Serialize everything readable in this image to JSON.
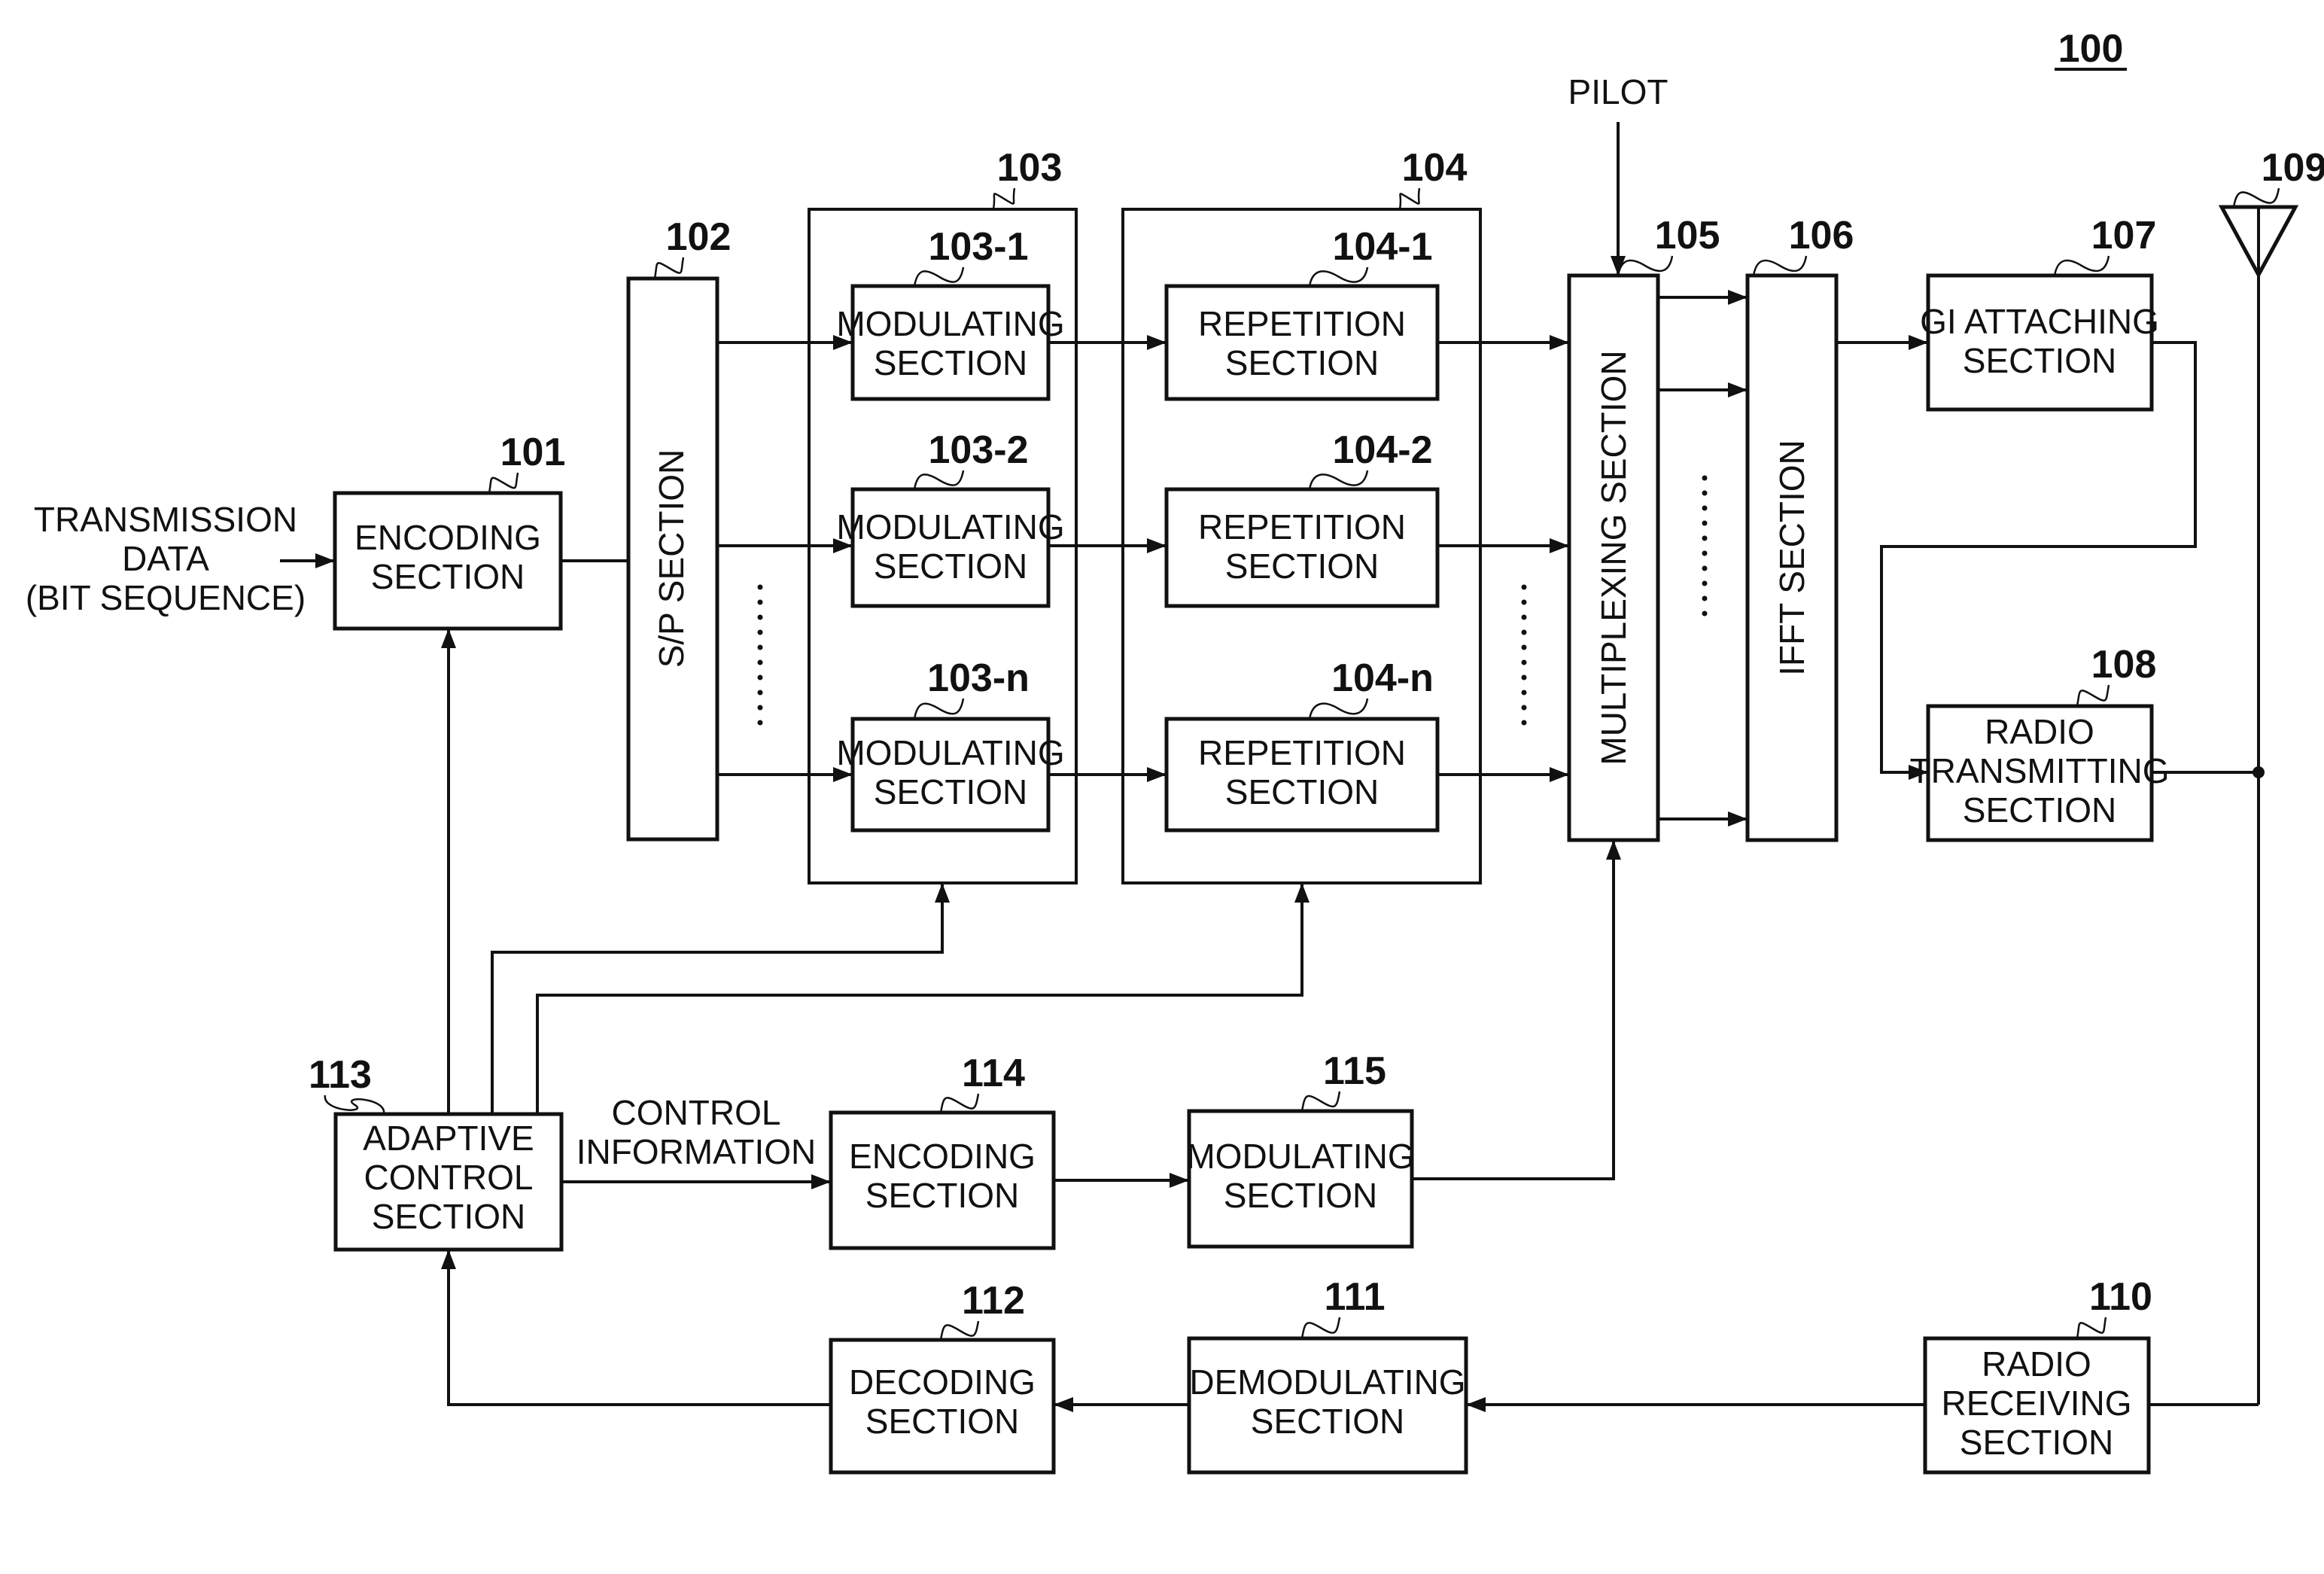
{
  "figure_number": "100",
  "input_label": [
    "TRANSMISSION",
    "DATA",
    "(BIT SEQUENCE)"
  ],
  "pilot_label": "PILOT",
  "control_info_label": [
    "CONTROL",
    "INFORMATION"
  ],
  "blocks": {
    "encoding_101": {
      "ref": "101",
      "lines": [
        "ENCODING",
        "SECTION"
      ]
    },
    "sp_102": {
      "ref": "102",
      "lines": [
        "S/P SECTION"
      ]
    },
    "modulating_group_103": {
      "ref": "103"
    },
    "modulating_103_1": {
      "ref": "103-1",
      "lines": [
        "MODULATING",
        "SECTION"
      ]
    },
    "modulating_103_2": {
      "ref": "103-2",
      "lines": [
        "MODULATING",
        "SECTION"
      ]
    },
    "modulating_103_n": {
      "ref": "103-n",
      "lines": [
        "MODULATING",
        "SECTION"
      ]
    },
    "repetition_group_104": {
      "ref": "104"
    },
    "repetition_104_1": {
      "ref": "104-1",
      "lines": [
        "REPETITION",
        "SECTION"
      ]
    },
    "repetition_104_2": {
      "ref": "104-2",
      "lines": [
        "REPETITION",
        "SECTION"
      ]
    },
    "repetition_104_n": {
      "ref": "104-n",
      "lines": [
        "REPETITION",
        "SECTION"
      ]
    },
    "multiplexing_105": {
      "ref": "105",
      "lines": [
        "MULTIPLEXING SECTION"
      ]
    },
    "ifft_106": {
      "ref": "106",
      "lines": [
        "IFFT SECTION"
      ]
    },
    "gi_107": {
      "ref": "107",
      "lines": [
        "GI ATTACHING",
        "SECTION"
      ]
    },
    "radio_tx_108": {
      "ref": "108",
      "lines": [
        "RADIO",
        "TRANSMITTING",
        "SECTION"
      ]
    },
    "antenna_109": {
      "ref": "109"
    },
    "radio_rx_110": {
      "ref": "110",
      "lines": [
        "RADIO",
        "RECEIVING",
        "SECTION"
      ]
    },
    "demodulating_111": {
      "ref": "111",
      "lines": [
        "DEMODULATING",
        "SECTION"
      ]
    },
    "decoding_112": {
      "ref": "112",
      "lines": [
        "DECODING",
        "SECTION"
      ]
    },
    "adaptive_113": {
      "ref": "113",
      "lines": [
        "ADAPTIVE",
        "CONTROL",
        "SECTION"
      ]
    },
    "encoding_114": {
      "ref": "114",
      "lines": [
        "ENCODING",
        "SECTION"
      ]
    },
    "modulating_115": {
      "ref": "115",
      "lines": [
        "MODULATING",
        "SECTION"
      ]
    }
  }
}
